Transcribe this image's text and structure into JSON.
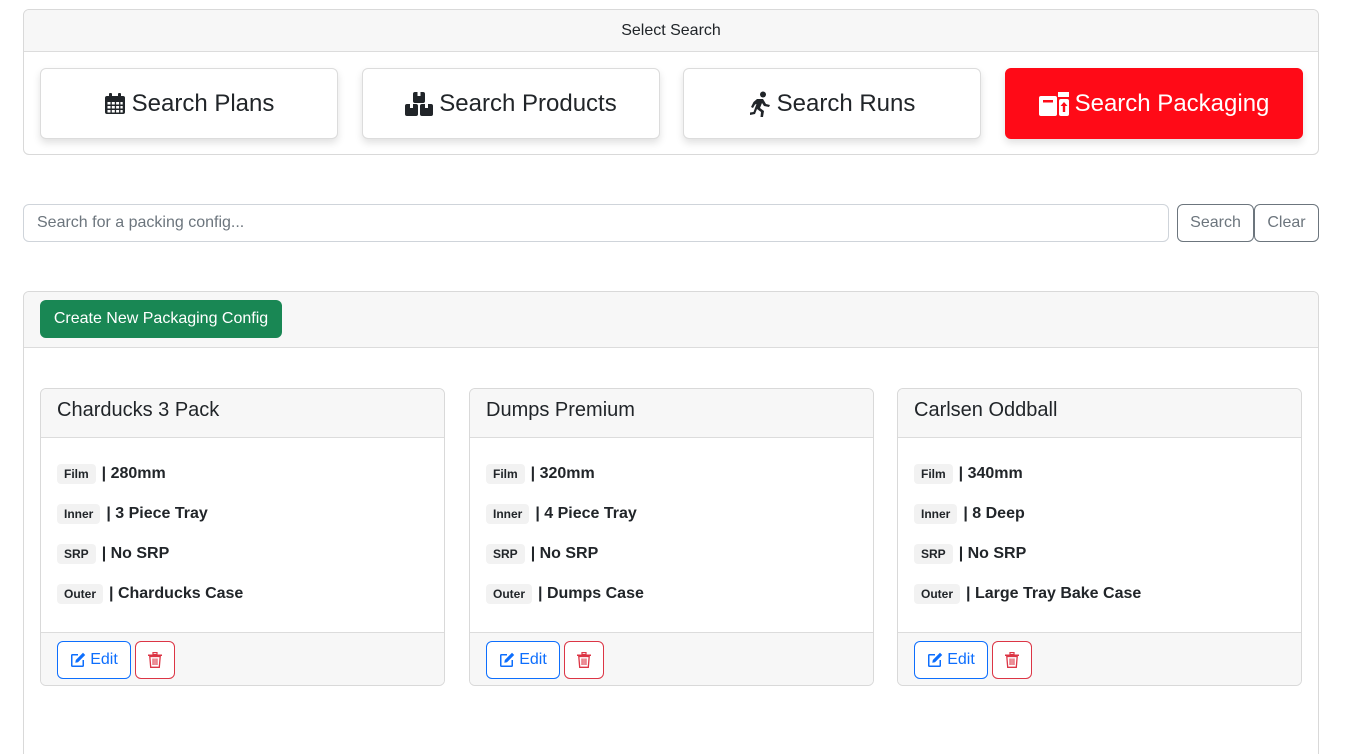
{
  "select_search": {
    "header": "Select Search",
    "buttons": [
      {
        "label": "Search Plans",
        "icon": "calendar-icon",
        "active": false
      },
      {
        "label": "Search Products",
        "icon": "boxes-icon",
        "active": false
      },
      {
        "label": "Search Runs",
        "icon": "running-person-icon",
        "active": false
      },
      {
        "label": "Search Packaging",
        "icon": "packaging-icon",
        "active": true
      }
    ],
    "active_color": "#ff0a17"
  },
  "search": {
    "placeholder": "Search for a packing config...",
    "value": "",
    "search_label": "Search",
    "clear_label": "Clear"
  },
  "list": {
    "create_label": "Create New Packaging Config",
    "create_color": "#198754",
    "items": [
      {
        "title": "Charducks 3 Pack",
        "fields": [
          {
            "label": "Film",
            "value": "| 280mm"
          },
          {
            "label": "Inner",
            "value": "| 3 Piece Tray"
          },
          {
            "label": "SRP",
            "value": "| No SRP"
          },
          {
            "label": "Outer",
            "value": "| Charducks Case"
          }
        ],
        "edit_label": "Edit"
      },
      {
        "title": "Dumps Premium",
        "fields": [
          {
            "label": "Film",
            "value": "| 320mm"
          },
          {
            "label": "Inner",
            "value": "| 4 Piece Tray"
          },
          {
            "label": "SRP",
            "value": "| No SRP"
          },
          {
            "label": "Outer",
            "value": "| Dumps Case"
          }
        ],
        "edit_label": "Edit"
      },
      {
        "title": "Carlsen Oddball",
        "fields": [
          {
            "label": "Film",
            "value": "| 340mm"
          },
          {
            "label": "Inner",
            "value": "| 8 Deep"
          },
          {
            "label": "SRP",
            "value": "| No SRP"
          },
          {
            "label": "Outer",
            "value": "| Large Tray Bake Case"
          }
        ],
        "edit_label": "Edit"
      }
    ]
  }
}
